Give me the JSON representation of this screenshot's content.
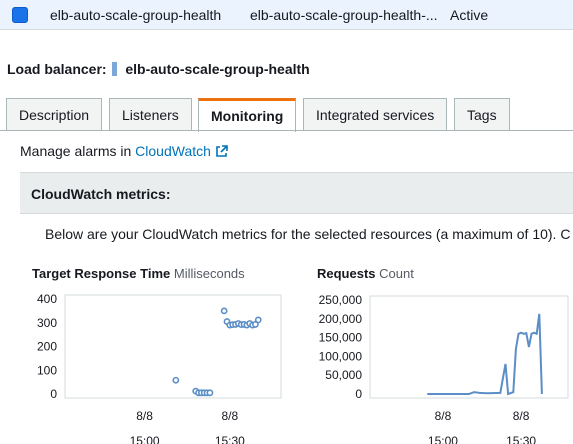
{
  "selected_row": {
    "name": "elb-auto-scale-group-health",
    "dns": "elb-auto-scale-group-health-...",
    "state": "Active"
  },
  "load_balancer": {
    "label": "Load balancer:",
    "name": "elb-auto-scale-group-health"
  },
  "tabs": [
    {
      "label": "Description"
    },
    {
      "label": "Listeners"
    },
    {
      "label": "Monitoring"
    },
    {
      "label": "Integrated services"
    },
    {
      "label": "Tags"
    }
  ],
  "active_tab": "Monitoring",
  "monitoring": {
    "manage_prefix": "Manage alarms in",
    "cloudwatch_link": "CloudWatch",
    "metrics_header": "CloudWatch metrics:",
    "metrics_description": "Below are your CloudWatch metrics for the selected resources (a maximum of 10). C"
  },
  "colors": {
    "line": "#5b8ec7",
    "accent": "#ec7211",
    "link": "#0073bb"
  },
  "chart_data": [
    {
      "type": "scatter",
      "title": "Target Response Time",
      "unit": "Milliseconds",
      "ylim": [
        0,
        400
      ],
      "yticks": [
        0,
        100,
        200,
        300,
        400
      ],
      "x_tick_dates": [
        "8/8",
        "8/8"
      ],
      "x_tick_times": [
        "15:00",
        "15:30"
      ],
      "x_range_minutes": [
        -28,
        48
      ],
      "x_tick_minutes": [
        0,
        30
      ],
      "series": [
        {
          "points": [
            {
              "x": 11,
              "y": 58
            },
            {
              "x": 18,
              "y": 12
            },
            {
              "x": 19,
              "y": 5
            },
            {
              "x": 20,
              "y": 5
            },
            {
              "x": 21,
              "y": 5
            },
            {
              "x": 22,
              "y": 5
            },
            {
              "x": 23,
              "y": 5
            },
            {
              "x": 28,
              "y": 350
            },
            {
              "x": 29,
              "y": 305
            },
            {
              "x": 30,
              "y": 290
            },
            {
              "x": 31,
              "y": 292
            },
            {
              "x": 32,
              "y": 293
            },
            {
              "x": 33,
              "y": 297
            },
            {
              "x": 34,
              "y": 292
            },
            {
              "x": 35,
              "y": 293
            },
            {
              "x": 36,
              "y": 290
            },
            {
              "x": 37,
              "y": 297
            },
            {
              "x": 38,
              "y": 290
            },
            {
              "x": 39,
              "y": 293
            },
            {
              "x": 40,
              "y": 312
            }
          ]
        }
      ]
    },
    {
      "type": "line",
      "title": "Requests",
      "unit": "Count",
      "ylim": [
        0,
        250000
      ],
      "yticks": [
        0,
        50000,
        100000,
        150000,
        200000,
        250000
      ],
      "ytick_labels": [
        "0",
        "50,000",
        "100,000",
        "150,000",
        "200,000",
        "250,000"
      ],
      "x_tick_dates": [
        "8/8",
        "8/8"
      ],
      "x_tick_times": [
        "15:00",
        "15:30"
      ],
      "x_range_minutes": [
        -28,
        48
      ],
      "x_tick_minutes": [
        0,
        30
      ],
      "series": [
        {
          "points": [
            {
              "x": -6,
              "y": 0
            },
            {
              "x": 10,
              "y": 0
            },
            {
              "x": 12,
              "y": 5000
            },
            {
              "x": 14,
              "y": 3000
            },
            {
              "x": 17,
              "y": 2000
            },
            {
              "x": 22,
              "y": 3000
            },
            {
              "x": 24,
              "y": 80000
            },
            {
              "x": 25,
              "y": 0
            },
            {
              "x": 27,
              "y": 5000
            },
            {
              "x": 28,
              "y": 120000
            },
            {
              "x": 29,
              "y": 160000
            },
            {
              "x": 30,
              "y": 163000
            },
            {
              "x": 31,
              "y": 160000
            },
            {
              "x": 32,
              "y": 162000
            },
            {
              "x": 33,
              "y": 125000
            },
            {
              "x": 34,
              "y": 160000
            },
            {
              "x": 35,
              "y": 163000
            },
            {
              "x": 36,
              "y": 160000
            },
            {
              "x": 37,
              "y": 213000
            },
            {
              "x": 38,
              "y": 0
            }
          ]
        }
      ]
    }
  ]
}
